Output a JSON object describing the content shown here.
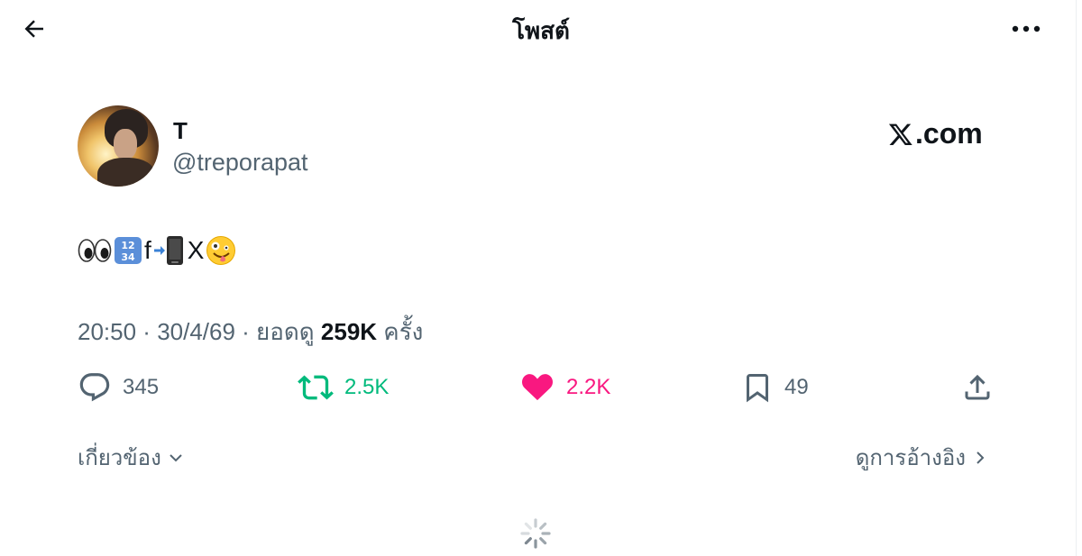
{
  "header": {
    "title": "โพสต์",
    "back_icon": "arrow-left-icon",
    "more_icon": "more-horizontal-icon"
  },
  "author": {
    "display_name": "T",
    "username": "@treporapat",
    "avatar": "avatar-image"
  },
  "watermark": {
    "text": ".com",
    "logo": "x-logo-icon"
  },
  "post": {
    "emojis": [
      "eyes-emoji",
      "input-numbers-emoji",
      "mobile-phone-with-arrow-emoji",
      "zany-face-emoji"
    ],
    "text_f": "f",
    "text_x": "X"
  },
  "meta": {
    "time": "20:50",
    "sep1": " · ",
    "date": "30/4/69",
    "sep2": " · ",
    "views_label": "ยอดดู",
    "views_count": "259K",
    "views_suffix": "ครั้ง"
  },
  "actions": {
    "reply": {
      "count": "345",
      "icon": "reply-icon",
      "color": "#536471"
    },
    "retweet": {
      "count": "2.5K",
      "icon": "retweet-icon",
      "color": "#00ba7c"
    },
    "like": {
      "count": "2.2K",
      "icon": "heart-filled-icon",
      "color": "#f91880"
    },
    "bookmark": {
      "count": "49",
      "icon": "bookmark-icon",
      "color": "#536471"
    },
    "share": {
      "icon": "share-icon"
    }
  },
  "footer": {
    "related_label": "เกี่ยวข้อง",
    "quotes_label": "ดูการอ้างอิง"
  },
  "colors": {
    "text_primary": "#0f1419",
    "text_secondary": "#536471",
    "retweet": "#00ba7c",
    "like": "#f91880"
  }
}
